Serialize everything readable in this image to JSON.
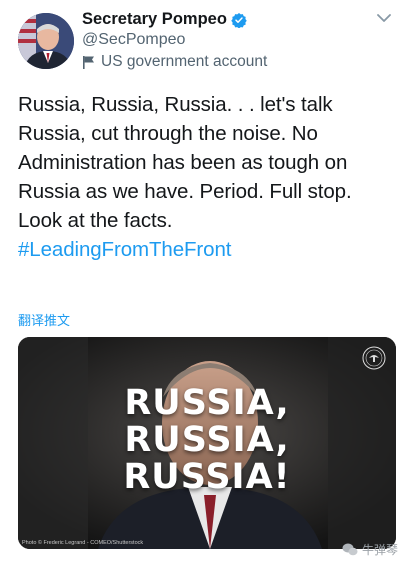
{
  "account": {
    "display_name": "Secretary Pompeo",
    "handle": "@SecPompeo",
    "label": "US government account"
  },
  "tweet": {
    "text": "Russia, Russia, Russia. . . let's talk Russia, cut through the noise. No Administration has been as tough on Russia as we have. Period. Full stop. Look at the facts.",
    "hashtag": "#LeadingFromTheFront",
    "translate_label": "翻译推文"
  },
  "media": {
    "headline": [
      "RUSSIA,",
      "RUSSIA,",
      "RUSSIA!"
    ],
    "credit": "Photo © Frederic Legrand - COMEO/Shutterstock"
  },
  "watermark": "牛弹琴",
  "colors": {
    "link": "#1d9bf0",
    "verified": "#1d9bf0",
    "muted": "#536471"
  }
}
